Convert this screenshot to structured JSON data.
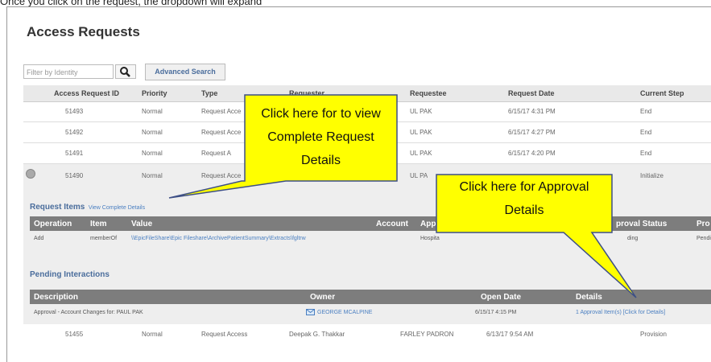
{
  "caption": "Once you click on the request, the dropdown will expand",
  "page_title": "Access Requests",
  "filter": {
    "placeholder": "Filter by Identity"
  },
  "advanced_search_label": "Advanced Search",
  "table": {
    "columns": [
      "Access Request ID",
      "Priority",
      "Type",
      "Requester",
      "Requestee",
      "Request Date",
      "Current Step"
    ],
    "rows": [
      {
        "id": "51493",
        "priority": "Normal",
        "type": "Request Acce",
        "requester": "",
        "requestee": "UL PAK",
        "date": "6/15/17 4:31 PM",
        "step": "End"
      },
      {
        "id": "51492",
        "priority": "Normal",
        "type": "Request Acce",
        "requester": "",
        "requestee": "UL PAK",
        "date": "6/15/17 4:27 PM",
        "step": "End"
      },
      {
        "id": "51491",
        "priority": "Normal",
        "type": "Request A",
        "requester": "",
        "requestee": "UL PAK",
        "date": "6/15/17 4:20 PM",
        "step": "End"
      },
      {
        "id": "51490",
        "priority": "Normal",
        "type": "Request Acce",
        "requester": "",
        "requestee": "UL PA",
        "date": "",
        "step": "Initialize"
      }
    ],
    "last_row": {
      "id": "51455",
      "priority": "Normal",
      "type": "Request Access",
      "requester": "Deepak G. Thakkar",
      "requestee": "FARLEY PADRON",
      "date": "6/13/17 9:54 AM",
      "step": "Provision"
    }
  },
  "request_items": {
    "title": "Request Items",
    "link": "View Complete Details",
    "columns": [
      "Operation",
      "Item",
      "Value",
      "Account",
      "Appl",
      "proval Status",
      "Pro"
    ],
    "row": {
      "operation": "Add",
      "item": "memberOf",
      "value": "\\\\EpicFileShare\\Epic Fileshare\\ArchivePatientSummary\\Extracts\\fgltrw",
      "account": "",
      "app": "Hospita",
      "status": "ding",
      "pro": "Pendi"
    }
  },
  "pending": {
    "title": "Pending Interactions",
    "columns": [
      "Description",
      "Owner",
      "Open Date",
      "Details"
    ],
    "row": {
      "description": "Approval - Account Changes for: PAUL PAK",
      "owner": "GEORGE MCALPINE",
      "open_date": "6/15/17 4:15 PM",
      "details": "1 Approval Item(s) [Click for Details]"
    }
  },
  "callouts": {
    "view_details": [
      "Click here for to view",
      "Complete Request",
      "Details"
    ],
    "approval": [
      "Click here for Approval",
      "Details"
    ]
  },
  "colors": {
    "callout_fill": "#ffff00",
    "callout_stroke": "#3d4f86",
    "accent": "#4a6d9c",
    "grid_header": "#7d7d7d"
  }
}
